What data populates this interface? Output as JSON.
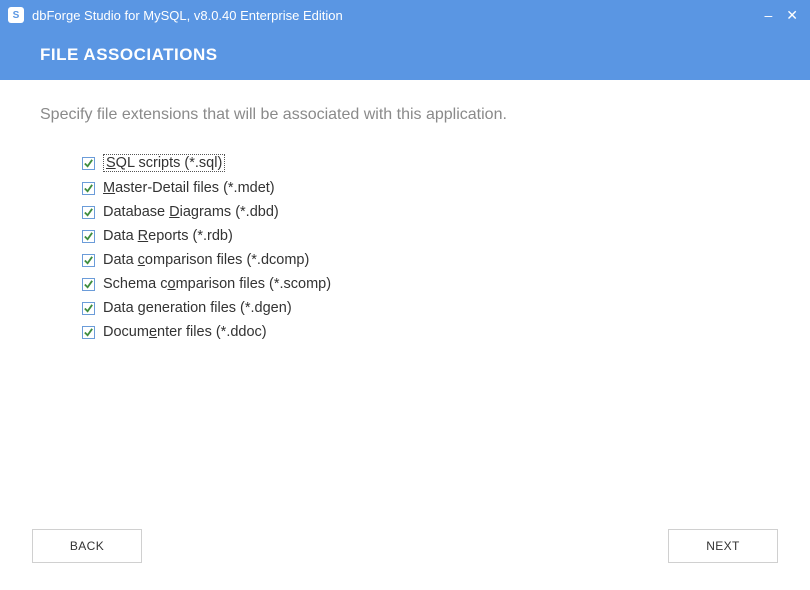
{
  "titlebar": {
    "app_icon_letter": "S",
    "title": "dbForge Studio for MySQL, v8.0.40 Enterprise Edition",
    "minimize": "–",
    "close": "✕"
  },
  "header": {
    "title": "FILE ASSOCIATIONS"
  },
  "instruction": "Specify file extensions that will be associated with this application.",
  "options": [
    {
      "pre": "",
      "mnemonic": "S",
      "post": "QL scripts (*.sql)",
      "checked": true,
      "focused": true
    },
    {
      "pre": "",
      "mnemonic": "M",
      "post": "aster-Detail files (*.mdet)",
      "checked": true,
      "focused": false
    },
    {
      "pre": "Database ",
      "mnemonic": "D",
      "post": "iagrams (*.dbd)",
      "checked": true,
      "focused": false
    },
    {
      "pre": "Data ",
      "mnemonic": "R",
      "post": "eports (*.rdb)",
      "checked": true,
      "focused": false
    },
    {
      "pre": "Data ",
      "mnemonic": "c",
      "post": "omparison files (*.dcomp)",
      "checked": true,
      "focused": false
    },
    {
      "pre": "Schema c",
      "mnemonic": "o",
      "post": "mparison files (*.scomp)",
      "checked": true,
      "focused": false
    },
    {
      "pre": "Data ",
      "mnemonic": "g",
      "post": "eneration files (*.dgen)",
      "checked": true,
      "focused": false
    },
    {
      "pre": "Docum",
      "mnemonic": "e",
      "post": "nter files (*.ddoc)",
      "checked": true,
      "focused": false
    }
  ],
  "footer": {
    "back_label": "BACK",
    "next_label": "NEXT"
  },
  "colors": {
    "accent": "#5a96e3",
    "check_stroke": "#3f8d3f"
  }
}
